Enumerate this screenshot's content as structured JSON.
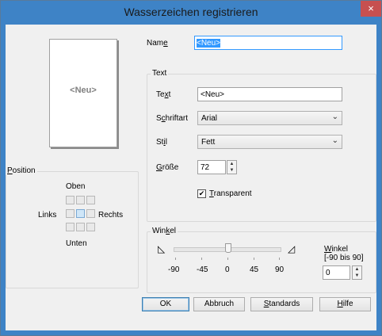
{
  "window": {
    "title": "Wasserzeichen registrieren",
    "close_glyph": "×"
  },
  "preview": {
    "label": "<Neu>"
  },
  "name_field": {
    "label": "Name",
    "underline_char": "e",
    "value": "<Neu>"
  },
  "text_group": {
    "title": "Text",
    "text_label": "Text",
    "text_value": "<Neu>",
    "font_label": "Schriftart",
    "font_value": "Arial",
    "style_label": "Stil",
    "style_value": "Fett",
    "size_label": "Größe",
    "size_value": "72",
    "transparent_label": "Transparent",
    "transparent_checked": true
  },
  "position_group": {
    "title": "Position",
    "top": "Oben",
    "left": "Links",
    "right": "Rechts",
    "bottom": "Unten"
  },
  "angle_group": {
    "title": "Winkel",
    "ticks": [
      "-90",
      "-45",
      "0",
      "45",
      "90"
    ],
    "value_label": "Winkel",
    "range_label": "[-90 bis 90]",
    "value": "0",
    "slider_value": 0
  },
  "buttons": {
    "ok": "OK",
    "cancel": "Abbruch",
    "defaults": "Standards",
    "help": "Hilfe"
  }
}
